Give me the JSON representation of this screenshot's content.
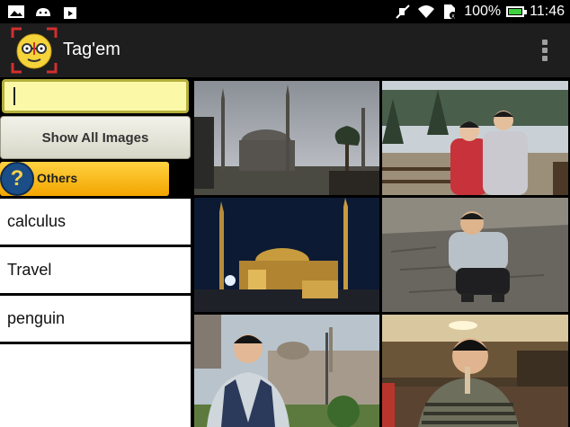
{
  "status_bar": {
    "left_icons": [
      "image-icon",
      "android-icon",
      "shopping-bag-icon"
    ],
    "right_icons": [
      "mute-icon",
      "wifi-icon",
      "sim-icon"
    ],
    "battery_text": "100%",
    "time": "11:46",
    "battery_color": "#3fcf3f"
  },
  "action_bar": {
    "title": "Tag'em",
    "overflow_icon": "overflow-menu-icon"
  },
  "sidebar": {
    "search_value": "",
    "show_all_label": "Show All Images",
    "others_label": "Others",
    "tags": [
      {
        "label": "calculus"
      },
      {
        "label": "Travel"
      },
      {
        "label": "penguin"
      }
    ]
  },
  "photos": [
    {
      "subject": "mosque-daytime"
    },
    {
      "subject": "couple-in-snow"
    },
    {
      "subject": "mosque-night"
    },
    {
      "subject": "man-crouching"
    },
    {
      "subject": "man-in-front-of-building"
    },
    {
      "subject": "man-in-restaurant"
    }
  ],
  "colors": {
    "search_bg": "#fbf9a8",
    "others_bg": "#f3a500",
    "actionbar_bg": "#1e1e1e"
  }
}
